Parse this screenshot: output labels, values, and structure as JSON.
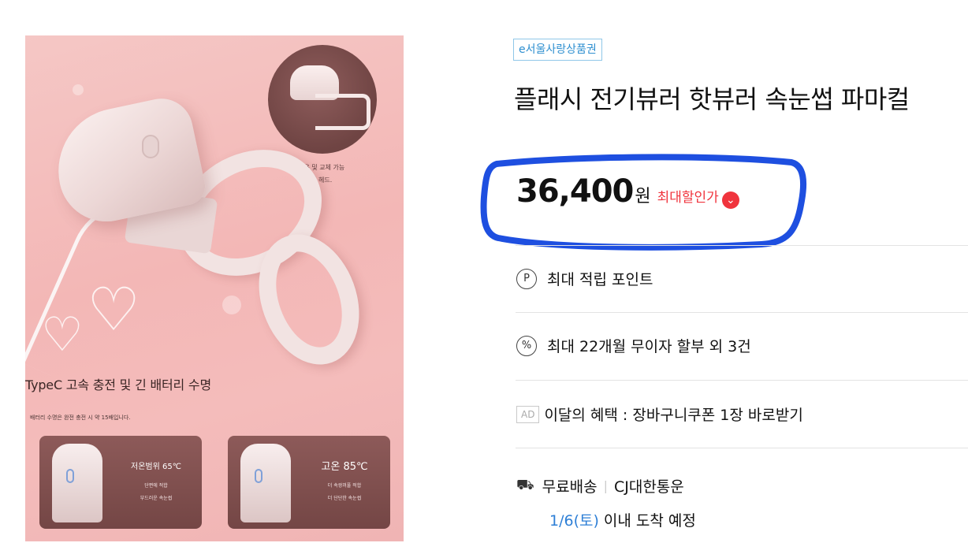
{
  "image_panel": {
    "inset_caption_line1": "휴대용 및 교체 가능",
    "inset_caption_line2": "가열 헤드.",
    "headline": "TypeC 고속 충전 및 긴 배터리 수명",
    "subline": "배터리 수명은 완전 충전 시 약 15배입니다.",
    "card_low": {
      "title": "저온범위 65℃",
      "line1": "단편에 적합",
      "line2": "부드러운 속눈썹"
    },
    "card_high": {
      "title": "고온 85℃",
      "line1": "더 속쌍꺼풀 적합",
      "line2": "더 단단한 속눈썹"
    }
  },
  "product": {
    "badge": "e서울사랑상품권",
    "title": "플래시 전기뷰러 핫뷰러 속눈썹 파마컬",
    "price": "36,400",
    "price_unit": "원",
    "price_tag": "최대할인가",
    "points": "최대 적립 포인트",
    "installment": "최대 22개월 무이자 할부 외 3건",
    "ad_label": "AD",
    "ad_text": "이달의 혜택 : 장바구니쿠폰 1장 바로받기",
    "shipping": "무료배송",
    "carrier": "CJ대한통운",
    "arrival_date": "1/6(토)",
    "arrival_text": " 이내 도착 예정"
  },
  "icons": {
    "points": "P",
    "installment": "%",
    "price_tag": "chevron-down-icon",
    "shipping": "truck-icon"
  },
  "colors": {
    "badge_blue": "#2e8fd0",
    "discount_red": "#f0343d",
    "highlight_blue": "#1e4fe0",
    "arrival_blue": "#2e7fd6"
  }
}
